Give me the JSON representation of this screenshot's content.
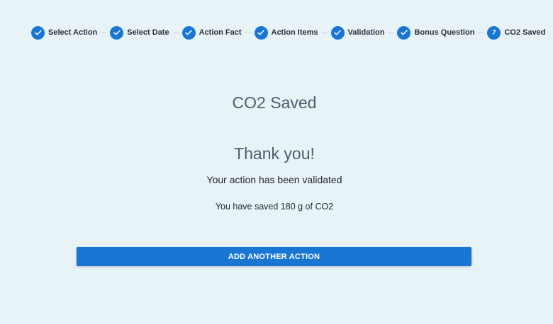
{
  "stepper": {
    "steps": [
      {
        "label": "Select Action",
        "state": "completed",
        "icon": "check-icon"
      },
      {
        "label": "Select Date",
        "state": "completed",
        "icon": "check-icon"
      },
      {
        "label": "Action Fact",
        "state": "completed",
        "icon": "check-icon"
      },
      {
        "label": "Action Items",
        "state": "completed",
        "icon": "check-icon"
      },
      {
        "label": "Validation",
        "state": "completed",
        "icon": "check-icon"
      },
      {
        "label": "Bonus Question",
        "state": "completed",
        "icon": "check-icon"
      },
      {
        "label": "CO2 Saved",
        "state": "active",
        "number": "7"
      }
    ]
  },
  "main": {
    "title": "CO2 Saved",
    "thanks": "Thank you!",
    "validated_message": "Your action has been validated",
    "saved_message": "You have saved 180 g of CO2",
    "button_label": "ADD ANOTHER ACTION"
  },
  "colors": {
    "accent": "#1976d2",
    "background": "#e8f3f8",
    "heading": "#4d5d6c",
    "text": "#222a31"
  }
}
